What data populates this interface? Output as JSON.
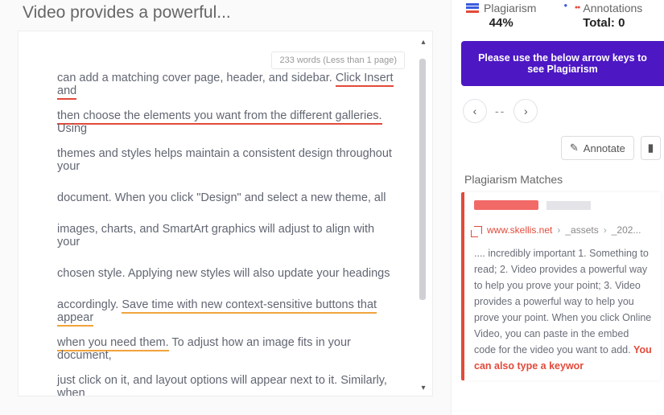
{
  "page_title": "Video provides a powerful...",
  "doc_meta": {
    "word_badge": "233 words (Less than 1 page)"
  },
  "lines": [
    {
      "pre": "",
      "hl": "",
      "cls": "ul-red",
      "hltext": "",
      "post": ""
    },
    {
      "pre": "can add a matching cover page, header, and sidebar. ",
      "hl": "Click Insert and",
      "cls": "ul-red",
      "post": ""
    },
    {
      "pre": "",
      "hl": "then choose the elements you want from the different galleries.",
      "cls": "ul-red",
      "post": " Using"
    },
    {
      "pre": "themes and styles helps maintain a consistent design throughout your",
      "hl": "",
      "cls": "",
      "post": ""
    },
    {
      "pre": "document. When you click \"Design\" and select a new theme, all",
      "hl": "",
      "cls": "",
      "post": ""
    },
    {
      "pre": "images, charts, and SmartArt graphics will adjust to align with your",
      "hl": "",
      "cls": "",
      "post": ""
    },
    {
      "pre": "chosen style. Applying new styles will also update your headings",
      "hl": "",
      "cls": "",
      "post": ""
    },
    {
      "pre": "accordingly. ",
      "hl": "Save time with new context-sensitive buttons that appear",
      "cls": "ul-orange",
      "post": ""
    },
    {
      "pre": "",
      "hl": "when you need them.",
      "cls": "ul-orange",
      "post": " To adjust how an image fits in your document,"
    },
    {
      "pre": "just click on it, and layout options will appear next to it. Similarly, when",
      "hl": "",
      "cls": "",
      "post": ""
    }
  ],
  "stats": {
    "plag_label": "Plagiarism",
    "plag_value": "44%",
    "ann_label": "Annotations",
    "ann_value": "Total: 0"
  },
  "banner": "Please use the below arrow keys to see Plagiarism",
  "nav": {
    "mid": "--"
  },
  "actions": {
    "annotate": "Annotate"
  },
  "matches": {
    "title": "Plagiarism Matches",
    "source": {
      "domain": "www.skellis.net",
      "seg1": "_assets",
      "seg2": "_202..."
    },
    "excerpt_plain": ".... incredibly important 1. Something to read; 2. Video provides a powerful way to help you prove your point; 3. Video provides a powerful way to help you prove your point. When you click Online Video, you can paste in the embed code for the video you want to add. ",
    "excerpt_hl": "You can also type a keywor"
  }
}
